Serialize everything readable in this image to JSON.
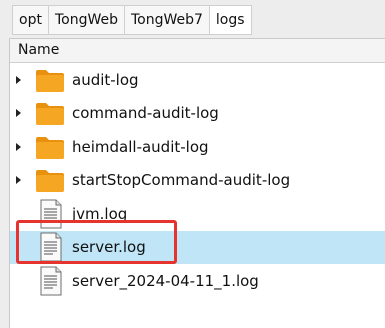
{
  "breadcrumb": [
    "opt",
    "TongWeb",
    "TongWeb7",
    "logs"
  ],
  "column_header": "Name",
  "items": [
    {
      "name": "audit-log",
      "type": "folder",
      "icon": "folder-icon"
    },
    {
      "name": "command-audit-log",
      "type": "folder",
      "icon": "folder-icon"
    },
    {
      "name": "heimdall-audit-log",
      "type": "folder",
      "icon": "folder-icon"
    },
    {
      "name": "startStopCommand-audit-log",
      "type": "folder",
      "icon": "folder-icon"
    },
    {
      "name": "jvm.log",
      "type": "file",
      "icon": "text-file-icon"
    },
    {
      "name": "server.log",
      "type": "file",
      "icon": "text-file-icon",
      "selected": true
    },
    {
      "name": "server_2024-04-11_1.log",
      "type": "file",
      "icon": "text-file-icon"
    }
  ],
  "colors": {
    "selected_row": "#bfe5f7",
    "highlight_box": "#e5342e",
    "folder": "#f2a21b"
  }
}
